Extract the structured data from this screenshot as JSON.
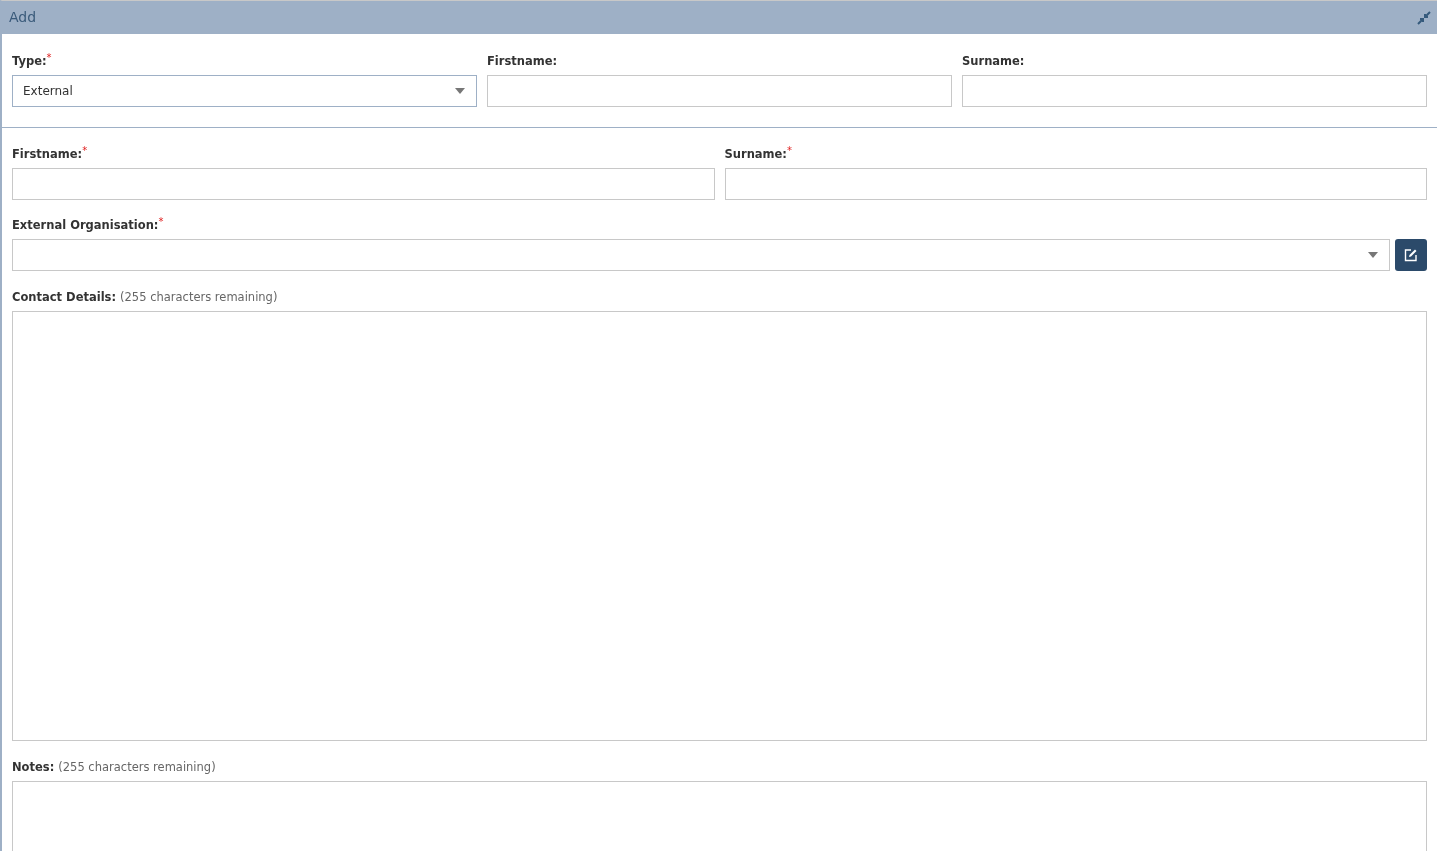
{
  "window": {
    "title": "Add"
  },
  "type_section": {
    "fields": [
      {
        "kind": "select",
        "label": "Type:",
        "required_mark": "*",
        "value": "External"
      },
      {
        "kind": "text",
        "label": "Firstname:"
      },
      {
        "kind": "text",
        "label": "Surname:"
      }
    ]
  },
  "details": {
    "name_fields": [
      {
        "label": "Firstname:",
        "required_mark": "*"
      },
      {
        "label": "Surname:",
        "required_mark": "*"
      }
    ],
    "organisation": {
      "label": "External Organisation:",
      "required_mark": "*"
    },
    "text_areas": [
      {
        "label": "Contact Details:",
        "hint": "(255 characters remaining)"
      },
      {
        "label": "Notes:",
        "hint": "(255 characters remaining)"
      }
    ]
  }
}
